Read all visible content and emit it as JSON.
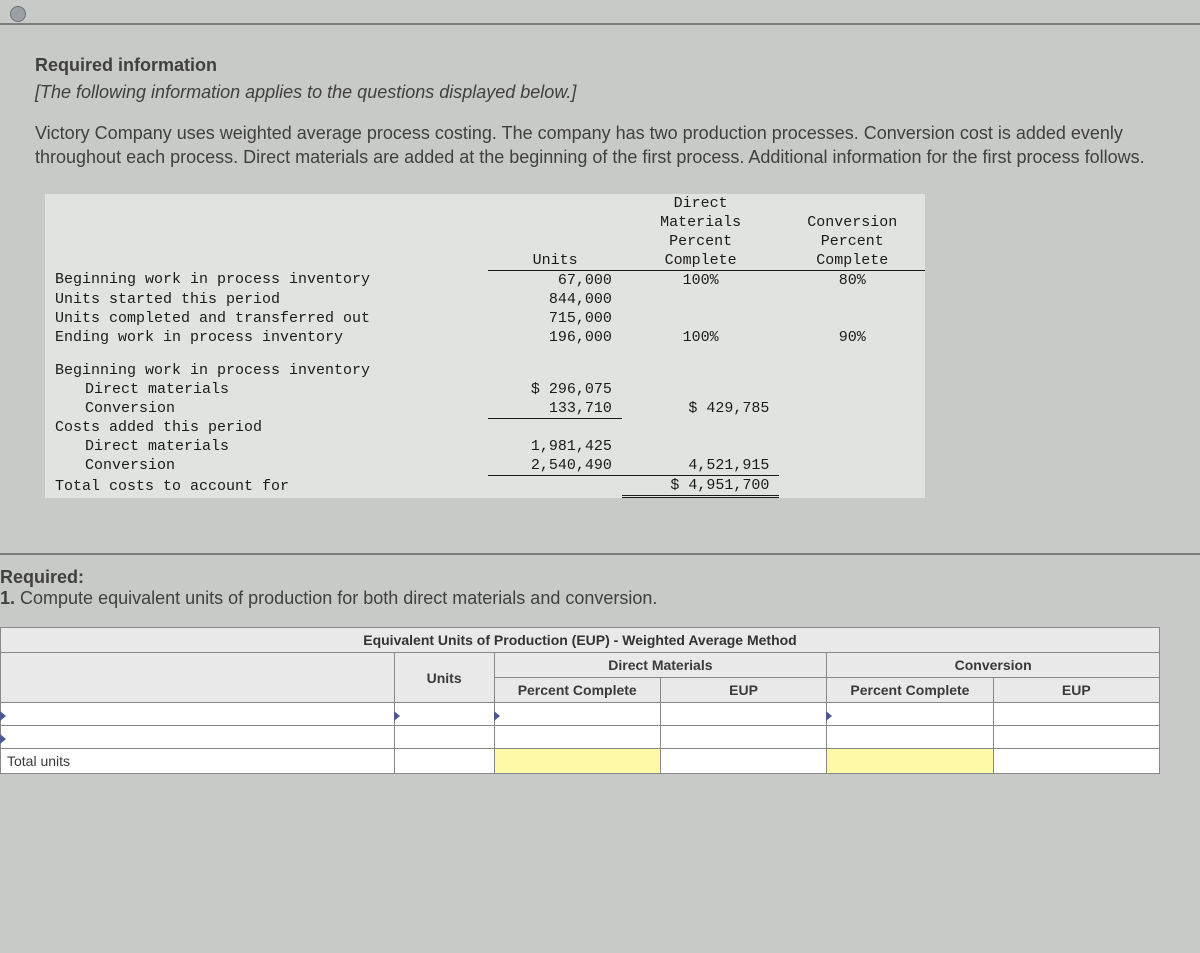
{
  "heading": "Required information",
  "context_note": "[The following information applies to the questions displayed below.]",
  "body_text": "Victory Company uses weighted average process costing. The company has two production processes. Conversion cost is added evenly throughout each process. Direct materials are added at the beginning of the first process. Additional information for the first process follows.",
  "data_headers": {
    "col_units": "Units",
    "col_dm1": "Direct",
    "col_dm2": "Materials",
    "col_pc": "Percent",
    "col_comp": "Complete",
    "col_conv": "Conversion"
  },
  "unit_rows": [
    {
      "label": "Beginning work in process inventory",
      "units": "67,000",
      "dm": "100%",
      "cv": "80%"
    },
    {
      "label": "Units started this period",
      "units": "844,000",
      "dm": "",
      "cv": ""
    },
    {
      "label": "Units completed and transferred out",
      "units": "715,000",
      "dm": "",
      "cv": ""
    },
    {
      "label": "Ending work in process inventory",
      "units": "196,000",
      "dm": "100%",
      "cv": "90%"
    }
  ],
  "cost_section": {
    "begin_label": "Beginning work in process inventory",
    "begin_dm_label": "Direct materials",
    "begin_dm_val": "$ 296,075",
    "begin_cv_label": "Conversion",
    "begin_cv_val": "133,710",
    "begin_total": "$ 429,785",
    "added_label": "Costs added this period",
    "added_dm_label": "Direct materials",
    "added_dm_val": "1,981,425",
    "added_cv_label": "Conversion",
    "added_cv_val": "2,540,490",
    "added_total": "4,521,915",
    "total_label": "Total costs to account for",
    "total_val": "$ 4,951,700"
  },
  "required_label": "Required:",
  "q1": "Compute equivalent units of production for both direct materials and conversion.",
  "q1_num": "1.",
  "answer_table": {
    "title": "Equivalent Units of Production (EUP) - Weighted Average Method",
    "blank": "",
    "units": "Units",
    "dm": "Direct Materials",
    "conv": "Conversion",
    "percent_complete": "Percent Complete",
    "eup": "EUP",
    "total_units": "Total units"
  }
}
